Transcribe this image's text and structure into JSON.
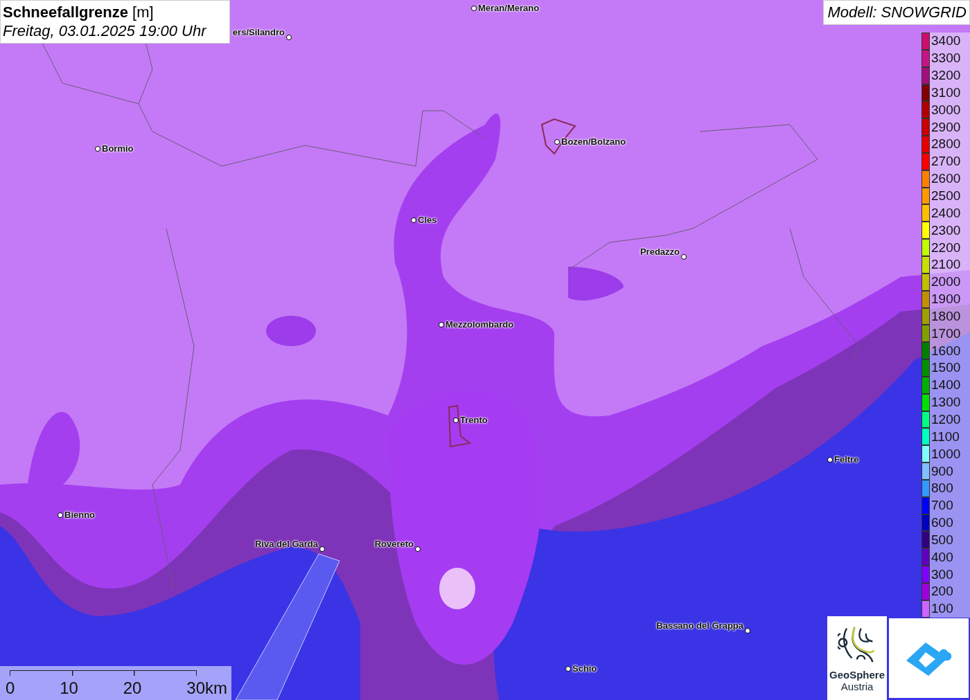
{
  "title": {
    "parameter": "Schneefallgrenze",
    "unit": "[m]",
    "datetime": "Freitag, 03.01.2025 19:00 Uhr"
  },
  "model_label": "Modell: SNOWGRID",
  "places": [
    {
      "name": "Meran/Merano",
      "kind": "city"
    },
    {
      "name": "ers/Silandro",
      "kind": "city"
    },
    {
      "name": "Bormio",
      "kind": "city"
    },
    {
      "name": "Bozen/Bolzano",
      "kind": "city"
    },
    {
      "name": "Cles",
      "kind": "city"
    },
    {
      "name": "Predazzo",
      "kind": "city"
    },
    {
      "name": "Mezzolombardo",
      "kind": "city"
    },
    {
      "name": "Trento",
      "kind": "city"
    },
    {
      "name": "Feltre",
      "kind": "city"
    },
    {
      "name": "Bienno",
      "kind": "city"
    },
    {
      "name": "Riva del Garda",
      "kind": "city"
    },
    {
      "name": "Rovereto",
      "kind": "city"
    },
    {
      "name": "Bassano del Grappa",
      "kind": "city"
    },
    {
      "name": "Schio",
      "kind": "city"
    }
  ],
  "legend": [
    {
      "label": "3400",
      "color": "#cc0f6a"
    },
    {
      "label": "3300",
      "color": "#c81482"
    },
    {
      "label": "3200",
      "color": "#a0107a"
    },
    {
      "label": "3100",
      "color": "#800000"
    },
    {
      "label": "3000",
      "color": "#b00000"
    },
    {
      "label": "2900",
      "color": "#cc0000"
    },
    {
      "label": "2800",
      "color": "#e60000"
    },
    {
      "label": "2700",
      "color": "#ff0000"
    },
    {
      "label": "2600",
      "color": "#ff8000"
    },
    {
      "label": "2500",
      "color": "#ff9900"
    },
    {
      "label": "2400",
      "color": "#ffc000"
    },
    {
      "label": "2300",
      "color": "#ffff00"
    },
    {
      "label": "2200",
      "color": "#c0ff00"
    },
    {
      "label": "2100",
      "color": "#c8e000"
    },
    {
      "label": "2000",
      "color": "#c0c000"
    },
    {
      "label": "1900",
      "color": "#c09000"
    },
    {
      "label": "1800",
      "color": "#a0a000"
    },
    {
      "label": "1700",
      "color": "#80a000"
    },
    {
      "label": "1600",
      "color": "#008000"
    },
    {
      "label": "1500",
      "color": "#009000"
    },
    {
      "label": "1400",
      "color": "#00b000"
    },
    {
      "label": "1300",
      "color": "#00e000"
    },
    {
      "label": "1200",
      "color": "#00ff80"
    },
    {
      "label": "1100",
      "color": "#00ffc0"
    },
    {
      "label": "1000",
      "color": "#80ffff"
    },
    {
      "label": "900",
      "color": "#80c0ff"
    },
    {
      "label": "800",
      "color": "#3399ff"
    },
    {
      "label": "700",
      "color": "#0000ff"
    },
    {
      "label": "600",
      "color": "#0000c0"
    },
    {
      "label": "500",
      "color": "#300080"
    },
    {
      "label": "400",
      "color": "#6000c0"
    },
    {
      "label": "300",
      "color": "#8000ff"
    },
    {
      "label": "200",
      "color": "#a000e0"
    },
    {
      "label": "100",
      "color": "#cc66ff"
    }
  ],
  "scale_bar": {
    "ticks": [
      "0",
      "10",
      "20",
      "30km"
    ]
  },
  "logo": {
    "name": "GeoSphere",
    "subtitle": "Austria"
  }
}
